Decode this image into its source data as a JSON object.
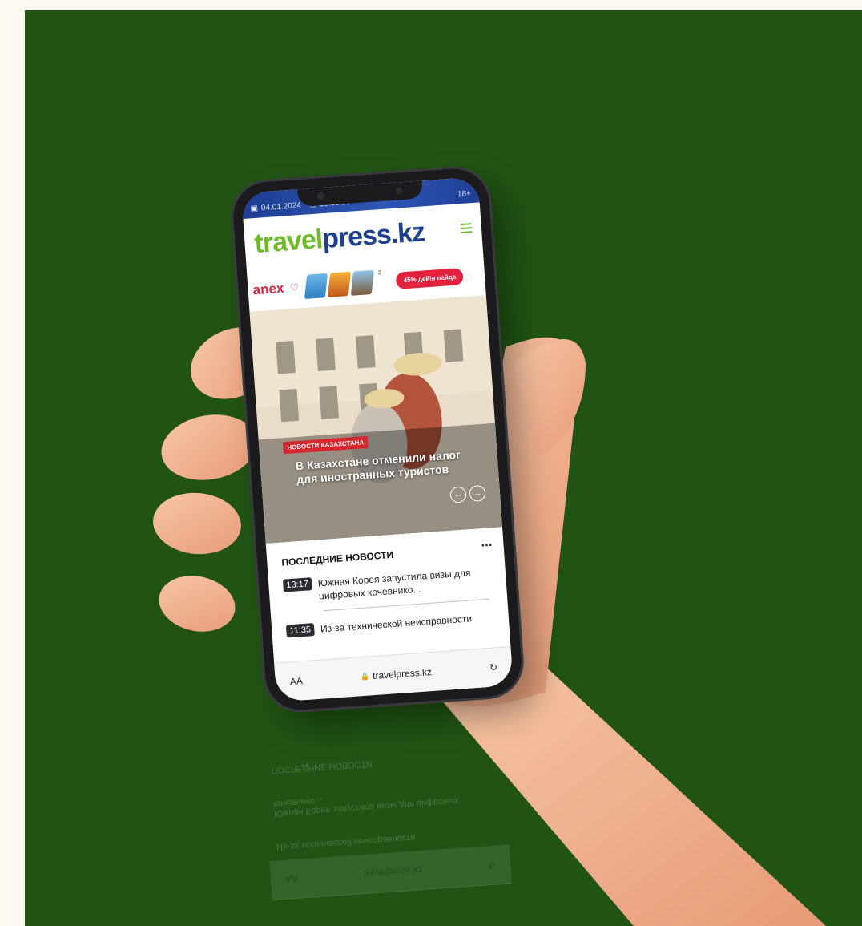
{
  "status_bar": {
    "date": "04.01.2024",
    "time": "13:30:29",
    "age_rating": "18+"
  },
  "header": {
    "logo_part1": "travel",
    "logo_part2": "press.kz",
    "menu_icon": "hamburger-icon"
  },
  "ad_banner": {
    "brand": "anex",
    "superscript": "2",
    "promo_label": "45% дейін пайда"
  },
  "hero": {
    "category": "НОВОСТИ КАЗАХСТАНА",
    "title": "В Казахстане отменили налог для иностранных туристов",
    "prev_icon": "arrow-left-icon",
    "next_icon": "arrow-right-icon"
  },
  "latest_news": {
    "title": "ПОСЛЕДНИЕ НОВОСТИ",
    "more_icon": "more-dots-icon",
    "items": [
      {
        "time": "13:17",
        "headline": "Южная Корея запустила визы для цифровых кочевнико..."
      },
      {
        "time": "11:35",
        "headline": "Из-за технической неисправности"
      }
    ]
  },
  "browser": {
    "text_size_label": "AA",
    "url": "travelpress.kz",
    "reload_icon": "reload-icon"
  },
  "colors": {
    "background": "#215414",
    "page_margin": "#fcf8f2",
    "logo_green": "#6fb92c",
    "logo_blue": "#1f3f8f",
    "accent_red": "#e2213d",
    "topbar_blue": "#2f56b5"
  }
}
